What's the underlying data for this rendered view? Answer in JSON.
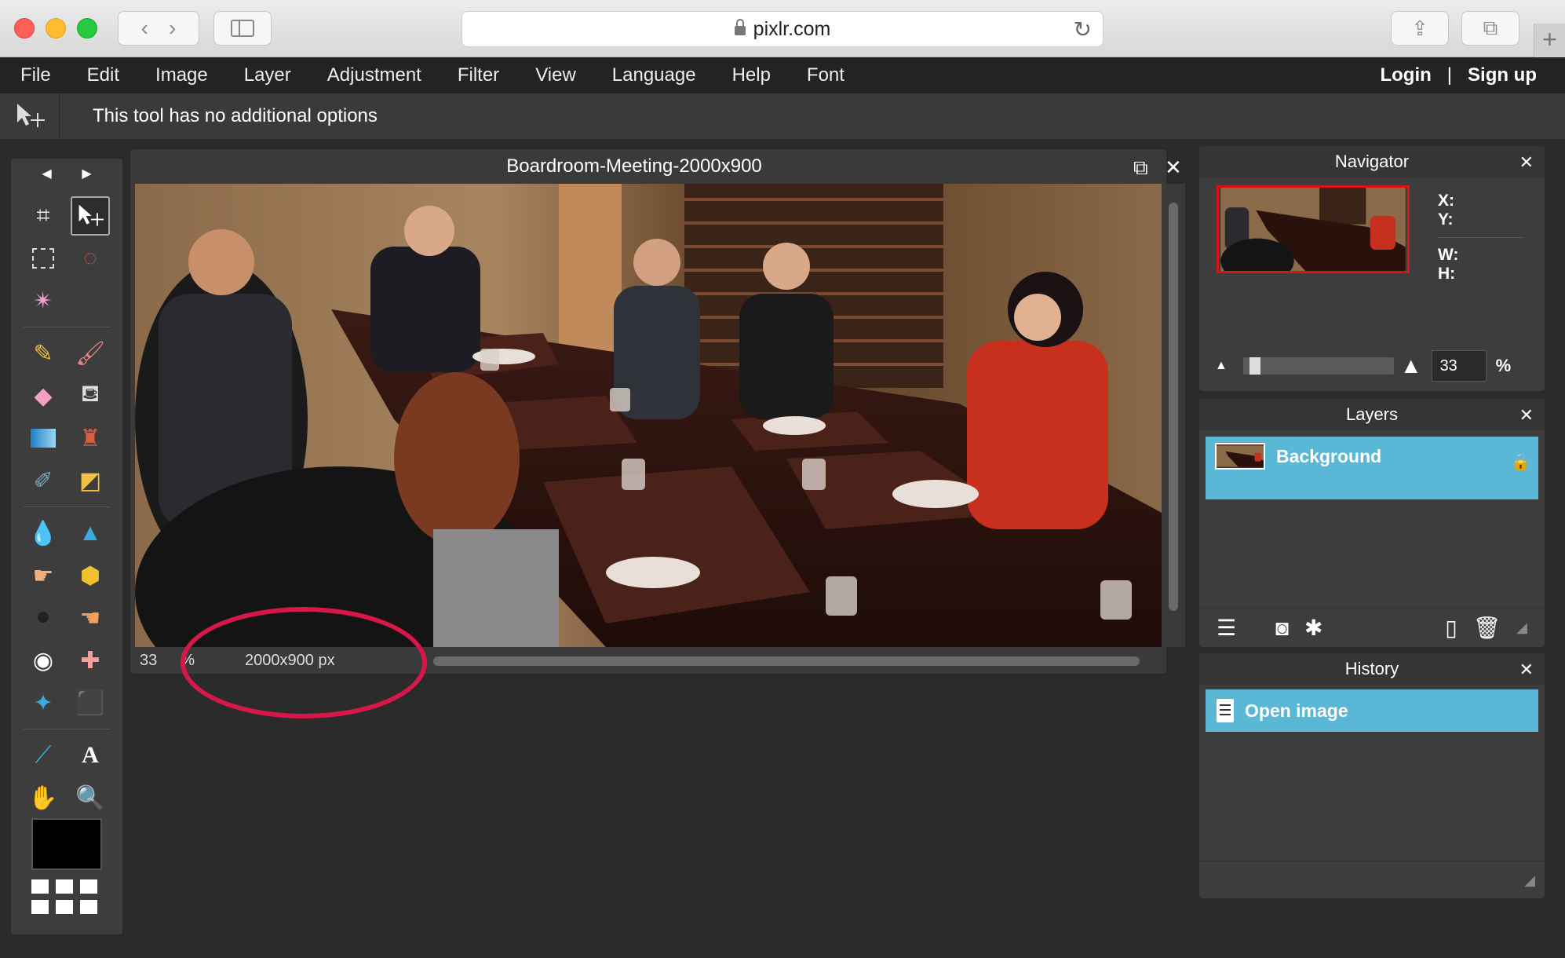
{
  "browser": {
    "url": "pixlr.com"
  },
  "menu": {
    "items": [
      "File",
      "Edit",
      "Image",
      "Layer",
      "Adjustment",
      "Filter",
      "View",
      "Language",
      "Help",
      "Font"
    ],
    "login": "Login",
    "separator": "|",
    "signup": "Sign up"
  },
  "options_bar": {
    "message": "This tool has no additional options"
  },
  "document": {
    "title": "Boardroom-Meeting-2000x900",
    "zoom": "33",
    "zoom_suffix": "%",
    "dimensions": "2000x900 px"
  },
  "navigator": {
    "title": "Navigator",
    "x_label": "X:",
    "y_label": "Y:",
    "w_label": "W:",
    "h_label": "H:",
    "zoom_value": "33",
    "zoom_unit": "%"
  },
  "layers": {
    "title": "Layers",
    "items": [
      {
        "name": "Background",
        "locked": true
      }
    ]
  },
  "history": {
    "title": "History",
    "items": [
      "Open image"
    ]
  },
  "colors": {
    "accent": "#5ab8d6",
    "highlight_ellipse": "#d7174a",
    "background": "#2b2b2b",
    "panel": "#3d3d3d"
  }
}
